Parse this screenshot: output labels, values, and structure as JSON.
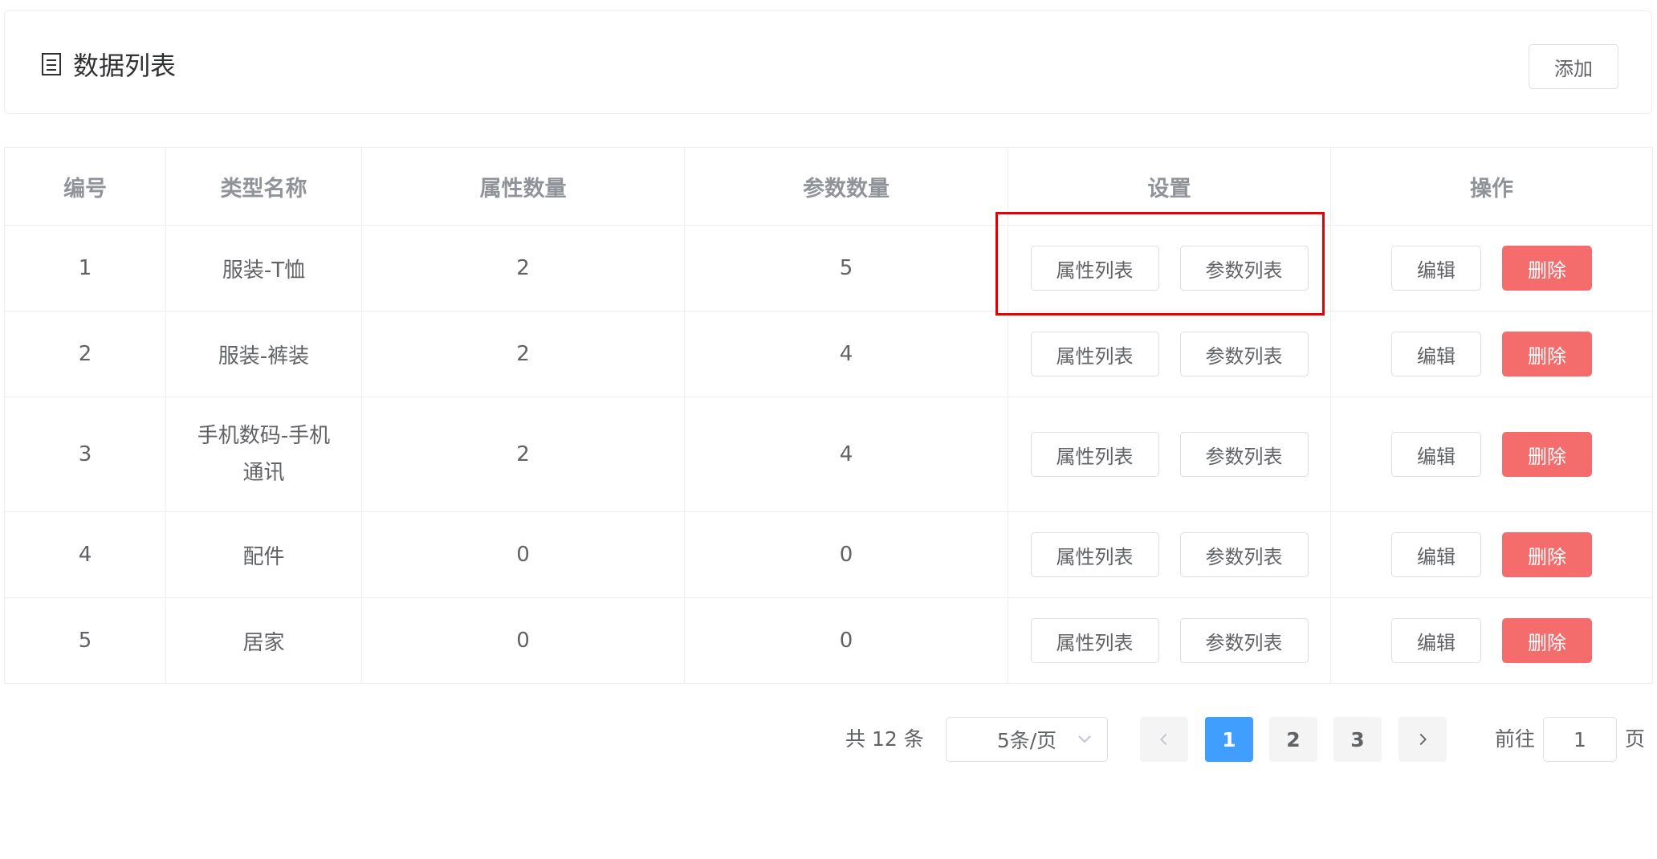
{
  "header": {
    "title": "数据列表",
    "add_label": "添加"
  },
  "table": {
    "columns": [
      "编号",
      "类型名称",
      "属性数量",
      "参数数量",
      "设置",
      "操作"
    ],
    "rows": [
      {
        "id": "1",
        "name": "服装-T恤",
        "attr_count": "2",
        "param_count": "5"
      },
      {
        "id": "2",
        "name": "服装-裤装",
        "attr_count": "2",
        "param_count": "4"
      },
      {
        "id": "3",
        "name_line1": "手机数码-手机",
        "name_line2": "通讯",
        "attr_count": "2",
        "param_count": "4"
      },
      {
        "id": "4",
        "name": "配件",
        "attr_count": "0",
        "param_count": "0"
      },
      {
        "id": "5",
        "name": "居家",
        "attr_count": "0",
        "param_count": "0"
      }
    ],
    "buttons": {
      "attr_list": "属性列表",
      "param_list": "参数列表",
      "edit": "编辑",
      "delete": "删除"
    }
  },
  "pagination": {
    "total": "共 12 条",
    "page_size": "5条/页",
    "pages": [
      "1",
      "2",
      "3"
    ],
    "current_page": "1",
    "goto_prefix": "前往",
    "goto_value": "1",
    "goto_suffix": "页"
  },
  "colors": {
    "primary": "#409eff",
    "danger": "#f56c6c",
    "highlight": "#e60000"
  }
}
